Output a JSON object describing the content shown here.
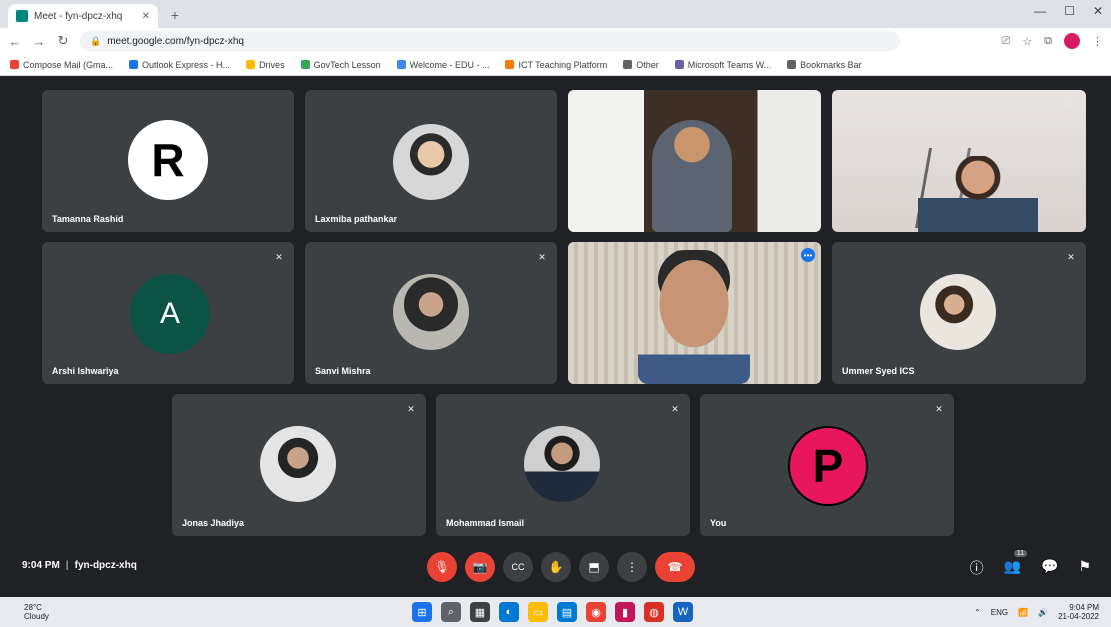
{
  "browser": {
    "tab_title": "Meet - fyn-dpcz-xhq",
    "url": "meet.google.com/fyn-dpcz-xhq",
    "new_tab_glyph": "+",
    "window_controls": [
      "—",
      "☐",
      "✕"
    ]
  },
  "bookmarks": [
    {
      "label": "Compose Mail (Gma...",
      "color": "#ea4335"
    },
    {
      "label": "Outlook Express - H...",
      "color": "#1a73e8"
    },
    {
      "label": "Drives",
      "color": "#fbbc04"
    },
    {
      "label": "GovTech Lesson",
      "color": "#34a853"
    },
    {
      "label": "Welcome - EDU - ...",
      "color": "#4285f4"
    },
    {
      "label": "ICT Teaching Platform",
      "color": "#f57c00"
    },
    {
      "label": "Other",
      "color": "#5f6368"
    },
    {
      "label": "Microsoft Teams W...",
      "color": "#6264a7"
    },
    {
      "label": "Bookmarks Bar",
      "color": "#5f6368"
    }
  ],
  "tiles": [
    {
      "name": "Tamanna Rashid",
      "avatar_letter": "R",
      "avatar_bg": "#ffffff",
      "avatar_fg": "#000000",
      "kind": "letter"
    },
    {
      "name": "Laxmiba pathankar",
      "kind": "photo"
    },
    {
      "name": "",
      "kind": "video"
    },
    {
      "name": "",
      "kind": "video"
    },
    {
      "name": "Arshi Ishwariya",
      "avatar_letter": "A",
      "avatar_bg": "#0b5345",
      "avatar_fg": "#ffffff",
      "kind": "letter"
    },
    {
      "name": "Sanvi Mishra",
      "kind": "photo"
    },
    {
      "name": "",
      "kind": "video"
    },
    {
      "name": "Ummer Syed ICS",
      "kind": "photo"
    },
    {
      "name": "Jonas Jhadiya",
      "kind": "photo"
    },
    {
      "name": "Mohammad Ismail",
      "kind": "photo"
    },
    {
      "name": "You",
      "avatar_letter": "P",
      "avatar_bg": "#e8175d",
      "avatar_fg": "#ffffff",
      "kind": "letter"
    }
  ],
  "meeting": {
    "time": "9:04 PM",
    "code": "fyn-dpcz-xhq"
  },
  "controls": {
    "mic_glyph": "🎙",
    "cam_glyph": "📷",
    "cc_glyph": "CC",
    "hand_glyph": "✋",
    "present_glyph": "⬒",
    "more_glyph": "⋮",
    "end_glyph": "☎"
  },
  "right_controls": {
    "info_glyph": "ⓘ",
    "people_glyph": "👥",
    "people_count": "11",
    "chat_glyph": "💬",
    "activities_glyph": "⚑"
  },
  "taskbar": {
    "weather_temp": "28°C",
    "weather_desc": "Cloudy",
    "time": "9:04 PM",
    "date": "21-04-2022",
    "lang": "ENG"
  }
}
